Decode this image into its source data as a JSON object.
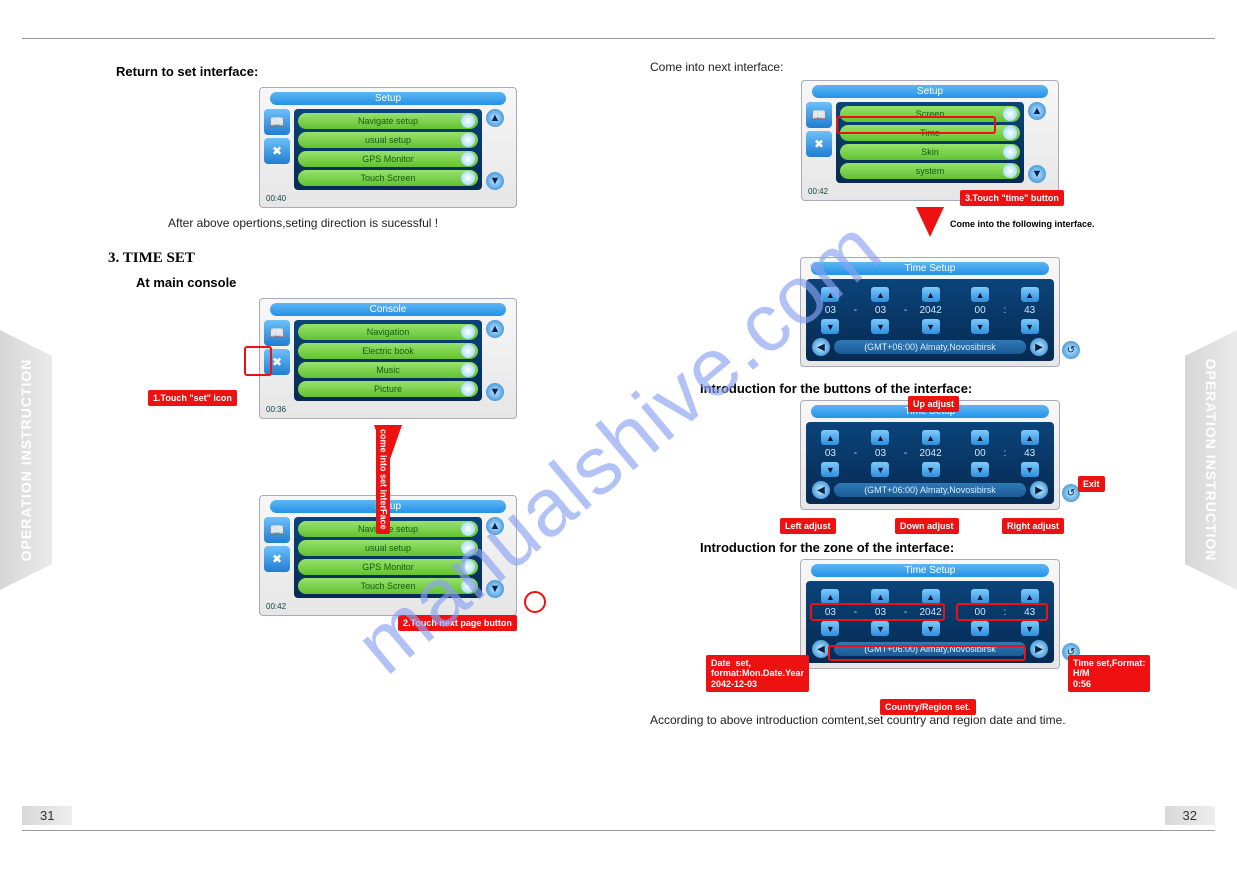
{
  "watermark": "manualshive.com",
  "side_tab": "OPERATION  INSTRUCTION",
  "page_left": "31",
  "page_right": "32",
  "left": {
    "return_heading": "Return to set interface:",
    "after_text": "After above opertions,seting direction is sucessful !",
    "section_heading": "3. TIME SET",
    "at_console": "At main console",
    "device_setup": {
      "title": "Setup",
      "clock": "00:40",
      "rows": [
        "Navigate setup",
        "usual setup",
        "GPS Monitor",
        "Touch Screen"
      ]
    },
    "device_console": {
      "title": "Console",
      "clock": "00:36",
      "rows": [
        "Navigation",
        "Electric book",
        "Music",
        "Picture"
      ]
    },
    "callout_set": "1.Touch \"set\" icon",
    "arrow_label": "come into set interFace",
    "device_setup2": {
      "title": "Setup",
      "clock": "00:42",
      "rows": [
        "Navigate setup",
        "usual setup",
        "GPS Monitor",
        "Touch Screen"
      ]
    },
    "callout_next": "2.Touch next page button"
  },
  "right": {
    "come_into": "Come into next interface:",
    "device_setup3": {
      "title": "Setup",
      "clock": "00:42",
      "rows": [
        "Screen",
        "Time",
        "Skin",
        "system"
      ]
    },
    "callout_time": "3.Touch \"time\" button",
    "arrow_label2": "Come into the following interface.",
    "time_panel": {
      "title": "Time Setup",
      "vals": [
        "03",
        "03",
        "2042",
        "00",
        "43"
      ],
      "seps": [
        "-",
        "-",
        ":",
        ":"
      ],
      "tz": "(GMT+06:00)  Almaty,Novosibirsk"
    },
    "intro_buttons": "Introduction for the buttons of the interface:",
    "labels_btn": {
      "up": "Up adjust",
      "down": "Down adjust",
      "left": "Left adjust",
      "right": "Right adjust",
      "exit": "Exit"
    },
    "intro_zone": "Introduction for the zone of the interface:",
    "labels_zone": {
      "date": "Date  set,\nformat:Mon.Date.Year\n2042-12-03",
      "country": "Country/Region set.",
      "time": "Time set,Format:\nH/M\n0:56"
    },
    "closing": "According to above introduction comtent,set country and region date and time."
  }
}
